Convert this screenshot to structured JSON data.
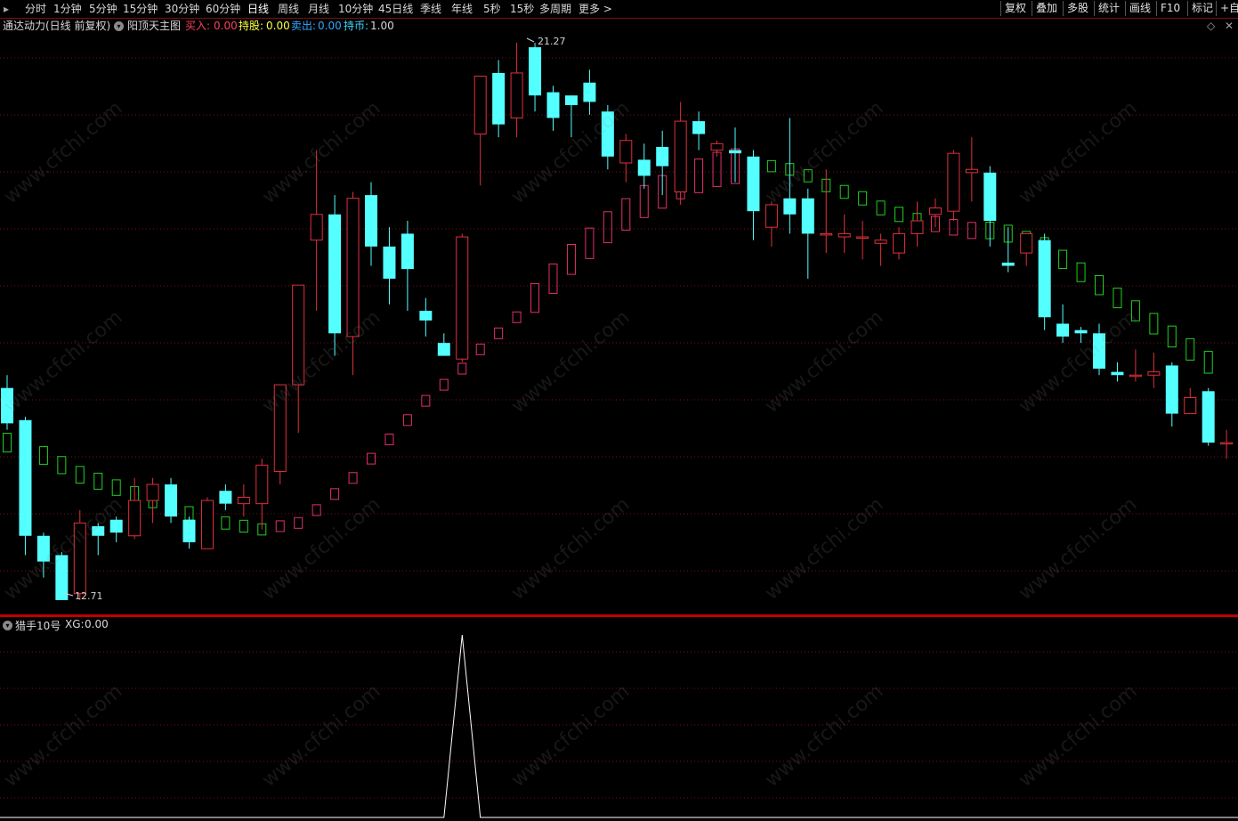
{
  "toolbar": {
    "periods": [
      "分时",
      "1分钟",
      "5分钟",
      "15分钟",
      "30分钟",
      "60分钟",
      "日线",
      "周线",
      "月线",
      "10分钟",
      "45日线",
      "季线",
      "年线",
      "5秒",
      "15秒",
      "多周期",
      "更多 >"
    ],
    "active_period": "日线",
    "right_buttons": [
      "复权",
      "叠加",
      "多股",
      "统计",
      "画线",
      "F10",
      "标记",
      "+自"
    ]
  },
  "info_bar": {
    "stock_name": "通达动力",
    "period_info": "(日线 前复权)",
    "indicator_name": "阳顶天主图",
    "buy_label": "买入:",
    "buy_value": "0.00",
    "hold_label": "持股:",
    "hold_value": "0.00",
    "sell_label": "卖出:",
    "sell_value": "0.00",
    "coin_label": "持币:",
    "coin_value": "1.00",
    "diamond_icon": "◇",
    "close_icon": "✕"
  },
  "main_chart": {
    "high_label": "21.27",
    "low_label": "12.71",
    "up_color": "#e0303c",
    "down_color": "#54ffff",
    "ma_up_color": "#e0306a",
    "ma_down_color": "#20d020",
    "grid_color": "#7a1010"
  },
  "chart_data": {
    "type": "candlestick",
    "price_range": [
      12.71,
      21.27
    ],
    "candles": [
      {
        "o": 15.9,
        "h": 16.1,
        "l": 15.25,
        "c": 15.35
      },
      {
        "o": 15.4,
        "h": 15.45,
        "l": 13.3,
        "c": 13.6
      },
      {
        "o": 13.6,
        "h": 13.65,
        "l": 12.95,
        "c": 13.2
      },
      {
        "o": 13.3,
        "h": 13.35,
        "l": 12.71,
        "c": 12.6
      },
      {
        "o": 12.7,
        "h": 14.0,
        "l": 12.6,
        "c": 13.8
      },
      {
        "o": 13.75,
        "h": 13.8,
        "l": 13.3,
        "c": 13.6
      },
      {
        "o": 13.85,
        "h": 13.9,
        "l": 13.5,
        "c": 13.65
      },
      {
        "o": 13.6,
        "h": 14.5,
        "l": 13.55,
        "c": 14.15
      },
      {
        "o": 14.15,
        "h": 14.5,
        "l": 13.8,
        "c": 14.4
      },
      {
        "o": 14.4,
        "h": 14.5,
        "l": 13.8,
        "c": 13.9
      },
      {
        "o": 13.85,
        "h": 13.9,
        "l": 13.4,
        "c": 13.5
      },
      {
        "o": 13.4,
        "h": 14.2,
        "l": 13.4,
        "c": 14.15
      },
      {
        "o": 14.3,
        "h": 14.4,
        "l": 14.0,
        "c": 14.1
      },
      {
        "o": 14.1,
        "h": 14.4,
        "l": 13.9,
        "c": 14.2
      },
      {
        "o": 14.1,
        "h": 14.8,
        "l": 13.7,
        "c": 14.7
      },
      {
        "o": 14.6,
        "h": 15.8,
        "l": 14.4,
        "c": 15.95
      },
      {
        "o": 15.95,
        "h": 17.5,
        "l": 15.2,
        "c": 17.5
      },
      {
        "o": 18.2,
        "h": 19.6,
        "l": 17.1,
        "c": 18.6
      },
      {
        "o": 18.6,
        "h": 18.9,
        "l": 16.4,
        "c": 16.75
      },
      {
        "o": 16.7,
        "h": 18.95,
        "l": 16.1,
        "c": 18.85
      },
      {
        "o": 18.9,
        "h": 19.1,
        "l": 17.8,
        "c": 18.1
      },
      {
        "o": 18.1,
        "h": 18.4,
        "l": 17.2,
        "c": 17.6
      },
      {
        "o": 18.3,
        "h": 18.5,
        "l": 17.1,
        "c": 17.75
      },
      {
        "o": 17.1,
        "h": 17.3,
        "l": 16.7,
        "c": 16.95
      },
      {
        "o": 16.6,
        "h": 16.75,
        "l": 16.4,
        "c": 16.4
      },
      {
        "o": 16.35,
        "h": 18.3,
        "l": 16.3,
        "c": 18.25
      },
      {
        "o": 19.85,
        "h": 20.35,
        "l": 19.05,
        "c": 20.75
      },
      {
        "o": 20.8,
        "h": 21.0,
        "l": 19.8,
        "c": 20.0
      },
      {
        "o": 20.1,
        "h": 21.27,
        "l": 19.8,
        "c": 20.8
      },
      {
        "o": 21.2,
        "h": 21.27,
        "l": 20.2,
        "c": 20.45
      },
      {
        "o": 20.5,
        "h": 20.6,
        "l": 19.9,
        "c": 20.1
      },
      {
        "o": 20.45,
        "h": 20.45,
        "l": 19.8,
        "c": 20.3
      },
      {
        "o": 20.65,
        "h": 20.85,
        "l": 20.15,
        "c": 20.35
      },
      {
        "o": 20.2,
        "h": 20.3,
        "l": 19.3,
        "c": 19.5
      },
      {
        "o": 19.4,
        "h": 19.85,
        "l": 19.1,
        "c": 19.75
      },
      {
        "o": 19.45,
        "h": 19.7,
        "l": 19.0,
        "c": 19.2
      },
      {
        "o": 19.65,
        "h": 19.9,
        "l": 18.9,
        "c": 19.35
      },
      {
        "o": 18.95,
        "h": 20.35,
        "l": 18.75,
        "c": 20.05
      },
      {
        "o": 20.05,
        "h": 20.2,
        "l": 19.6,
        "c": 19.85
      },
      {
        "o": 19.6,
        "h": 19.75,
        "l": 19.5,
        "c": 19.7
      },
      {
        "o": 19.6,
        "h": 19.95,
        "l": 19.1,
        "c": 19.55
      },
      {
        "o": 19.5,
        "h": 19.6,
        "l": 18.2,
        "c": 18.65
      },
      {
        "o": 18.4,
        "h": 18.8,
        "l": 18.1,
        "c": 18.75
      },
      {
        "o": 18.85,
        "h": 20.1,
        "l": 18.3,
        "c": 18.6
      },
      {
        "o": 18.85,
        "h": 19.0,
        "l": 17.6,
        "c": 18.3
      },
      {
        "o": 18.3,
        "h": 19.3,
        "l": 18.0,
        "c": 18.3
      },
      {
        "o": 18.25,
        "h": 18.6,
        "l": 18.0,
        "c": 18.3
      },
      {
        "o": 18.25,
        "h": 18.5,
        "l": 17.9,
        "c": 18.25
      },
      {
        "o": 18.15,
        "h": 18.3,
        "l": 17.8,
        "c": 18.2
      },
      {
        "o": 18.0,
        "h": 18.4,
        "l": 17.9,
        "c": 18.3
      },
      {
        "o": 18.3,
        "h": 18.8,
        "l": 18.1,
        "c": 18.5
      },
      {
        "o": 18.6,
        "h": 18.85,
        "l": 18.4,
        "c": 18.7
      },
      {
        "o": 18.65,
        "h": 19.6,
        "l": 18.5,
        "c": 19.55
      },
      {
        "o": 19.25,
        "h": 19.8,
        "l": 18.8,
        "c": 19.3
      },
      {
        "o": 19.25,
        "h": 19.35,
        "l": 18.1,
        "c": 18.5
      },
      {
        "o": 17.85,
        "h": 18.4,
        "l": 17.7,
        "c": 17.8
      },
      {
        "o": 18.0,
        "h": 18.25,
        "l": 17.8,
        "c": 18.3
      },
      {
        "o": 18.2,
        "h": 18.3,
        "l": 16.8,
        "c": 17.0
      },
      {
        "o": 16.9,
        "h": 17.2,
        "l": 16.6,
        "c": 16.7
      },
      {
        "o": 16.8,
        "h": 16.85,
        "l": 16.6,
        "c": 16.75
      },
      {
        "o": 16.75,
        "h": 16.9,
        "l": 16.1,
        "c": 16.2
      },
      {
        "o": 16.15,
        "h": 16.3,
        "l": 16.0,
        "c": 16.1
      },
      {
        "o": 16.1,
        "h": 16.5,
        "l": 16.0,
        "c": 16.1
      },
      {
        "o": 16.1,
        "h": 16.45,
        "l": 15.9,
        "c": 16.15
      },
      {
        "o": 16.25,
        "h": 16.3,
        "l": 15.3,
        "c": 15.5
      },
      {
        "o": 15.5,
        "h": 15.9,
        "l": 15.5,
        "c": 15.75
      },
      {
        "o": 15.85,
        "h": 15.9,
        "l": 15.0,
        "c": 15.05
      },
      {
        "o": 15.05,
        "h": 15.25,
        "l": 14.8,
        "c": 15.05
      },
      {
        "o": 15.0,
        "h": 15.35,
        "l": 14.8,
        "c": 14.7
      }
    ],
    "ma_line": [
      {
        "v": 15.05,
        "d": 1
      },
      {
        "v": 15.05,
        "d": 1
      },
      {
        "v": 14.85,
        "d": 1
      },
      {
        "v": 14.7,
        "d": 1
      },
      {
        "v": 14.55,
        "d": 1
      },
      {
        "v": 14.45,
        "d": 1
      },
      {
        "v": 14.35,
        "d": 1
      },
      {
        "v": 14.25,
        "d": 1
      },
      {
        "v": 14.15,
        "d": 1
      },
      {
        "v": 14.05,
        "d": 1
      },
      {
        "v": 13.95,
        "d": 1
      },
      {
        "v": 13.85,
        "d": 1
      },
      {
        "v": 13.8,
        "d": 1
      },
      {
        "v": 13.75,
        "d": 1
      },
      {
        "v": 13.7,
        "d": 1
      },
      {
        "v": 13.75,
        "d": 0
      },
      {
        "v": 13.8,
        "d": 0
      },
      {
        "v": 14.0,
        "d": 0
      },
      {
        "v": 14.25,
        "d": 0
      },
      {
        "v": 14.5,
        "d": 0
      },
      {
        "v": 14.8,
        "d": 0
      },
      {
        "v": 15.1,
        "d": 0
      },
      {
        "v": 15.4,
        "d": 0
      },
      {
        "v": 15.7,
        "d": 0
      },
      {
        "v": 15.95,
        "d": 0
      },
      {
        "v": 16.2,
        "d": 0
      },
      {
        "v": 16.5,
        "d": 0
      },
      {
        "v": 16.75,
        "d": 0
      },
      {
        "v": 17.0,
        "d": 0
      },
      {
        "v": 17.3,
        "d": 0
      },
      {
        "v": 17.6,
        "d": 0
      },
      {
        "v": 17.9,
        "d": 0
      },
      {
        "v": 18.15,
        "d": 0
      },
      {
        "v": 18.4,
        "d": 0
      },
      {
        "v": 18.6,
        "d": 0
      },
      {
        "v": 18.8,
        "d": 0
      },
      {
        "v": 18.95,
        "d": 0
      },
      {
        "v": 19.1,
        "d": 0
      },
      {
        "v": 19.2,
        "d": 0
      },
      {
        "v": 19.3,
        "d": 0
      },
      {
        "v": 19.35,
        "d": 0
      },
      {
        "v": 19.35,
        "d": 1
      },
      {
        "v": 19.35,
        "d": 1
      },
      {
        "v": 19.3,
        "d": 1
      },
      {
        "v": 19.2,
        "d": 1
      },
      {
        "v": 19.05,
        "d": 1
      },
      {
        "v": 18.95,
        "d": 1
      },
      {
        "v": 18.85,
        "d": 1
      },
      {
        "v": 18.7,
        "d": 1
      },
      {
        "v": 18.6,
        "d": 1
      },
      {
        "v": 18.5,
        "d": 1
      },
      {
        "v": 18.45,
        "d": 0
      },
      {
        "v": 18.4,
        "d": 0
      },
      {
        "v": 18.35,
        "d": 0
      },
      {
        "v": 18.35,
        "d": 1
      },
      {
        "v": 18.3,
        "d": 1
      },
      {
        "v": 18.2,
        "d": 1
      },
      {
        "v": 18.1,
        "d": 1
      },
      {
        "v": 17.9,
        "d": 1
      },
      {
        "v": 17.7,
        "d": 1
      },
      {
        "v": 17.5,
        "d": 1
      },
      {
        "v": 17.3,
        "d": 1
      },
      {
        "v": 17.1,
        "d": 1
      },
      {
        "v": 16.9,
        "d": 1
      },
      {
        "v": 16.7,
        "d": 1
      },
      {
        "v": 16.5,
        "d": 1
      },
      {
        "v": 16.3,
        "d": 1
      }
    ],
    "sub_indicator": {
      "name": "猎手10号",
      "series_label": "XG:",
      "series_value": "0.00",
      "signal_index": 25,
      "signal_value": 1
    }
  },
  "watermark": "www.cfchi.com"
}
